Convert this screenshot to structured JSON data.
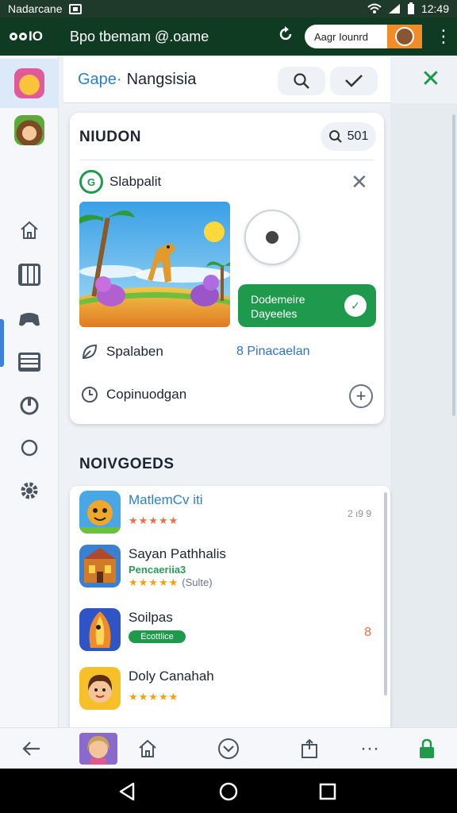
{
  "status_bar": {
    "carrier": "Nadarcane",
    "time": "12:49"
  },
  "app_bar": {
    "brand": "IO",
    "title": "Bpo tbemam @.oame",
    "account_label": "Aagr Iounrd"
  },
  "search": {
    "brand": "Gape·",
    "query": "Nangsisia"
  },
  "featured_card": {
    "title": "NIUDON",
    "search_chip": "501",
    "item_name": "Slabpalit",
    "badge": "G",
    "action_line1": "Dodemeire",
    "action_line2": "Dayeeles",
    "row1_label": "Spalaben",
    "row1_link": "8 Pinacaelan",
    "row2_label": "Copinuodgan"
  },
  "section": {
    "title": "NOIVGOEDS"
  },
  "games": [
    {
      "name": "MatlemCv iti",
      "side": "2 ı9 9",
      "rating": "★★★★★"
    },
    {
      "name": "Sayan Pathhalis",
      "subtitle": "Pencaeriia3",
      "rating": "★★★★★",
      "rating_text": "(Sulte)"
    },
    {
      "name": "Soilpas",
      "pill": "Ecottlice",
      "side": "8"
    },
    {
      "name": "Doly Canahah",
      "rating": "★★★★★"
    }
  ],
  "colors": {
    "app_bar": "#0f3b22",
    "accent_green": "#1f9a4c",
    "accent_blue": "#2b7fd1"
  }
}
